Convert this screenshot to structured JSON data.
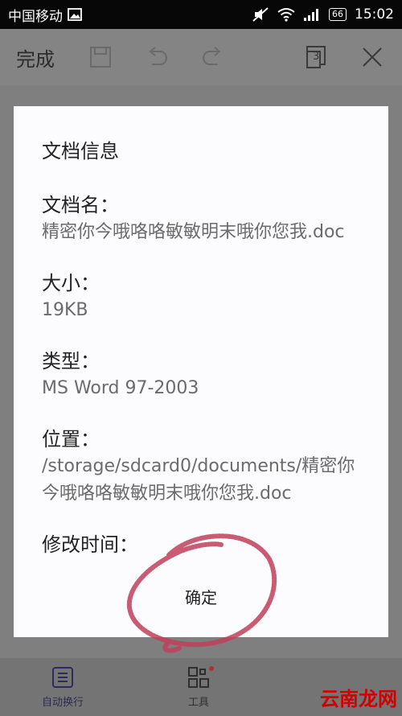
{
  "statusbar": {
    "carrier": "中国移动",
    "battery": "66",
    "time": "15:02"
  },
  "toolbar": {
    "done_label": "完成",
    "tab_count": "3"
  },
  "dialog": {
    "title": "文档信息",
    "fields": [
      {
        "label": "文档名：",
        "value": "精密你今哦咯咯敏敏明末哦你您我.doc"
      },
      {
        "label": "大小：",
        "value": "19KB"
      },
      {
        "label": "类型：",
        "value": "MS Word 97-2003"
      },
      {
        "label": "位置：",
        "value": "/storage/sdcard0/documents/精密你今哦咯咯敏敏明末哦你您我.doc"
      },
      {
        "label": "修改时间：",
        "value": ""
      }
    ],
    "ok_label": "确定"
  },
  "bottombar": {
    "wrap_label": "自动换行",
    "tools_label": "工具"
  },
  "watermark": "云南龙网",
  "colors": {
    "accent": "#2c2c4c",
    "scribble": "#c0405a",
    "dialog_bg": "#fcfbfd"
  }
}
